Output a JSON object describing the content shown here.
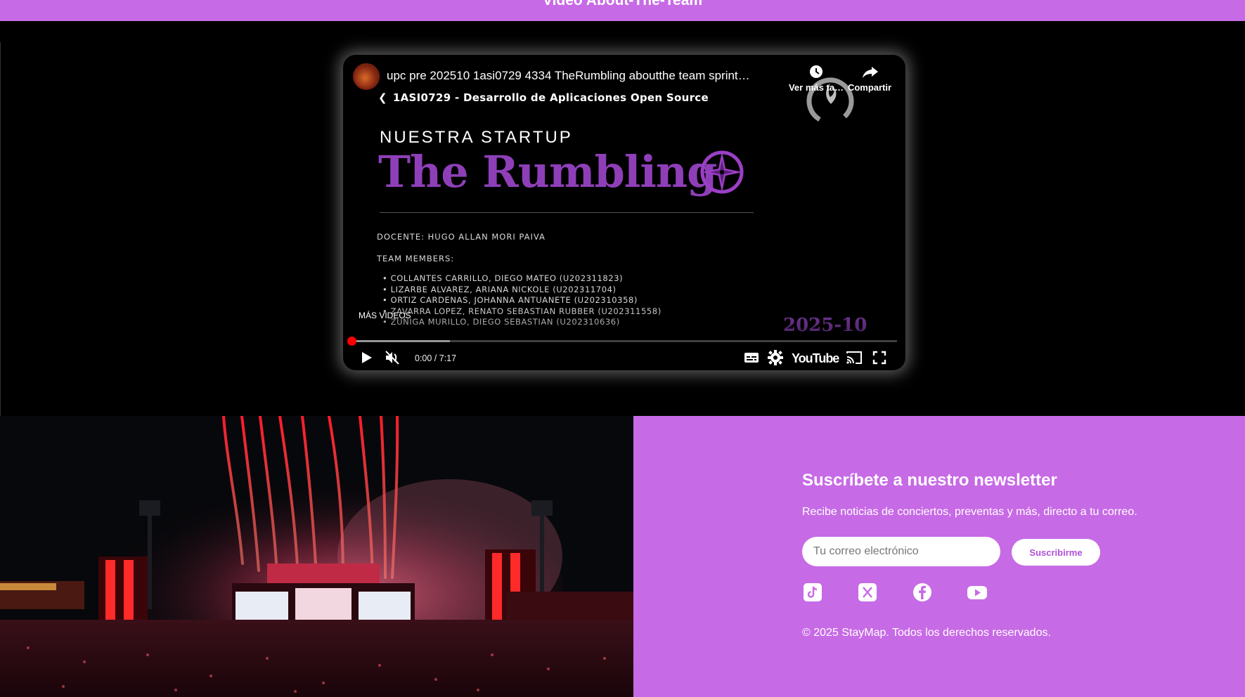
{
  "header": {
    "title": "Video About-The-Team"
  },
  "video": {
    "title": "upc pre 202510 1asi0729 4334 TheRumbling aboutthe team sprint…",
    "watch_later_label": "Ver más ta…",
    "share_label": "Compartir",
    "more_videos_label": "MÁS VIDEOS",
    "time_display": "0:00 / 7:17",
    "progress_buffered_fraction": 0.18,
    "youtube_logo_text": "YouTube",
    "slide": {
      "course": "1ASI0729 - Desarrollo de Aplicaciones Open Source",
      "startup_label": "NUESTRA STARTUP",
      "startup_name": "The Rumbling",
      "docente": "DOCENTE:  HUGO ALLAN MORI PAIVA",
      "team_label": "TEAM MEMBERS:",
      "members": [
        "COLLANTES CARRILLO, DIEGO MATEO (U202311823)",
        "LIZARBE ALVAREZ, ARIANA NICKOLE (U202311704)",
        "ORTIZ CARDENAS, JOHANNA ANTUANETE (U202310358)",
        "ZAVARRA LOPEZ, RENATO SEBASTIAN RUBBER (U202311558)",
        "ZUÑIGA MURILLO, DIEGO SEBASTIAN (U202310636)"
      ],
      "year": "2025-10"
    }
  },
  "newsletter": {
    "title": "Suscríbete a nuestro newsletter",
    "description": "Recibe noticias de conciertos, preventas y más, directo a tu correo.",
    "email_placeholder": "Tu correo electrónico",
    "email_value": "",
    "subscribe_label": "Suscribirme",
    "socials": [
      "tiktok-icon",
      "x-icon",
      "facebook-icon",
      "youtube-icon"
    ],
    "copyright": "© 2025 StayMap. Todos los derechos reservados."
  },
  "colors": {
    "accent_purple": "#c76ae6",
    "slide_title_purple": "#8e3fb8",
    "progress_red": "#ff0000"
  }
}
